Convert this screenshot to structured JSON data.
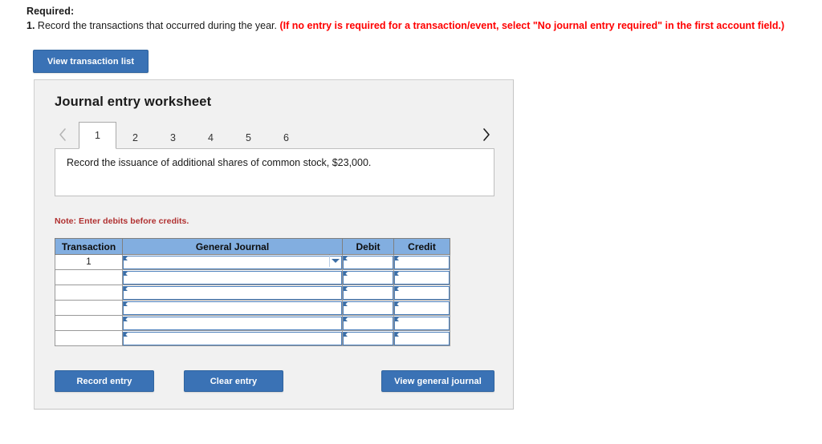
{
  "instructions": {
    "required_label": "Required:",
    "item_number": "1.",
    "item_text": "Record the transactions that occurred during the year.",
    "item_note_red": "(If no entry is required for a transaction/event, select \"No journal entry required\" in the first account field.)"
  },
  "buttons": {
    "view_transaction_list": "View transaction list",
    "record_entry": "Record entry",
    "clear_entry": "Clear entry",
    "view_general_journal": "View general journal"
  },
  "worksheet": {
    "title": "Journal entry worksheet",
    "prev_icon": "chevron-left-icon",
    "next_icon": "chevron-right-icon",
    "tabs": [
      {
        "label": "1",
        "active": true
      },
      {
        "label": "2",
        "active": false
      },
      {
        "label": "3",
        "active": false
      },
      {
        "label": "4",
        "active": false
      },
      {
        "label": "5",
        "active": false
      },
      {
        "label": "6",
        "active": false
      }
    ],
    "description": "Record the issuance of additional shares of common stock, $23,000.",
    "note": "Note: Enter debits before credits."
  },
  "journal_table": {
    "headers": [
      "Transaction",
      "General Journal",
      "Debit",
      "Credit"
    ],
    "rows": [
      {
        "transaction": "1",
        "general_journal": "",
        "debit": "",
        "credit": "",
        "has_dropdown": true
      },
      {
        "transaction": "",
        "general_journal": "",
        "debit": "",
        "credit": "",
        "has_dropdown": false
      },
      {
        "transaction": "",
        "general_journal": "",
        "debit": "",
        "credit": "",
        "has_dropdown": false
      },
      {
        "transaction": "",
        "general_journal": "",
        "debit": "",
        "credit": "",
        "has_dropdown": false
      },
      {
        "transaction": "",
        "general_journal": "",
        "debit": "",
        "credit": "",
        "has_dropdown": false
      },
      {
        "transaction": "",
        "general_journal": "",
        "debit": "",
        "credit": "",
        "has_dropdown": false
      }
    ]
  },
  "colors": {
    "button_blue": "#3a72b5",
    "table_header_blue": "#82aee0",
    "input_border_blue": "#4a7ebb",
    "note_red": "#b03030",
    "instruction_red": "#ff0000",
    "panel_background": "#f1f1f1"
  }
}
